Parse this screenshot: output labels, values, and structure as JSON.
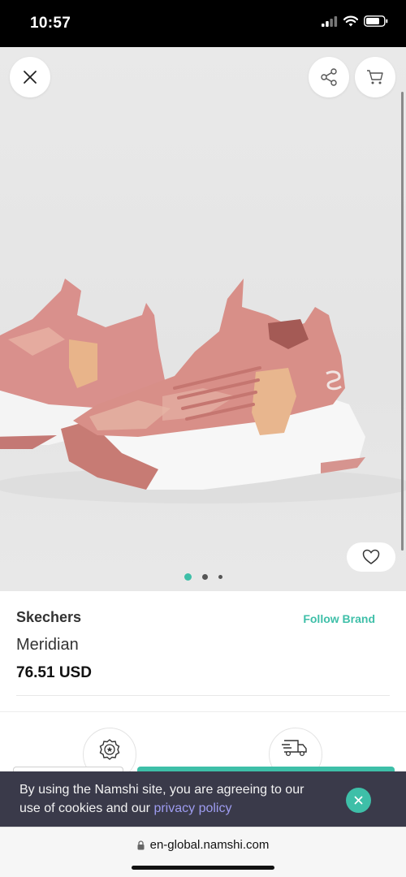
{
  "status_bar": {
    "time": "10:57",
    "icons": [
      "signal-icon",
      "wifi-icon",
      "battery-icon"
    ]
  },
  "hero": {
    "buttons": {
      "close": "close-icon",
      "share": "share-icon",
      "cart": "cart-icon",
      "wishlist": "heart-icon"
    },
    "carousel": {
      "total": 3,
      "active_index": 0
    }
  },
  "product": {
    "brand": "Skechers",
    "follow_label": "Follow Brand",
    "name": "Meridian",
    "price": "76.51 USD"
  },
  "features": {
    "icons": [
      "badge-icon",
      "delivery-truck-icon"
    ]
  },
  "cookie_banner": {
    "text": "By using the Namshi site, you are agreeing to our use of cookies and our ",
    "link_text": "privacy policy"
  },
  "browser": {
    "url": "en-global.namshi.com"
  },
  "colors": {
    "accent": "#3ebfa8",
    "banner_bg": "#3a3a4a",
    "link": "#9e9cf0"
  }
}
